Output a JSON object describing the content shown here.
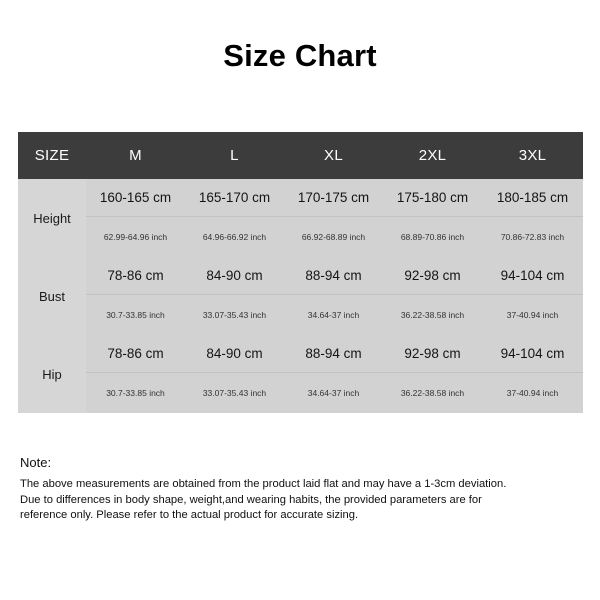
{
  "title": "Size Chart",
  "table": {
    "header": [
      "SIZE",
      "M",
      "L",
      "XL",
      "2XL",
      "3XL"
    ],
    "rows": [
      {
        "label": "Height",
        "cm": [
          "160-165 cm",
          "165-170 cm",
          "170-175 cm",
          "175-180 cm",
          "180-185 cm"
        ],
        "inch": [
          "62.99-64.96 inch",
          "64.96-66.92 inch",
          "66.92-68.89 inch",
          "68.89-70.86 inch",
          "70.86-72.83 inch"
        ]
      },
      {
        "label": "Bust",
        "cm": [
          "78-86 cm",
          "84-90 cm",
          "88-94 cm",
          "92-98 cm",
          "94-104 cm"
        ],
        "inch": [
          "30.7-33.85 inch",
          "33.07-35.43 inch",
          "34.64-37 inch",
          "36.22-38.58 inch",
          "37-40.94 inch"
        ]
      },
      {
        "label": "Hip",
        "cm": [
          "78-86 cm",
          "84-90 cm",
          "88-94 cm",
          "92-98 cm",
          "94-104 cm"
        ],
        "inch": [
          "30.7-33.85 inch",
          "33.07-35.43 inch",
          "34.64-37 inch",
          "36.22-38.58 inch",
          "37-40.94 inch"
        ]
      }
    ]
  },
  "note": {
    "heading": "Note:",
    "lines": [
      "The above measurements are obtained from the product laid flat and may have a 1-3cm deviation.",
      "Due to differences in body shape, weight,and wearing habits, the provided parameters are for",
      "reference only. Please refer to the actual product for accurate sizing."
    ]
  },
  "colors": {
    "header_bg": "#3c3c3c",
    "header_text": "#ffffff",
    "label_cell_bg": "#d6d6d6",
    "data_cell_bg": "#d2d2d2",
    "page_bg": "#ffffff",
    "text": "#101010"
  }
}
